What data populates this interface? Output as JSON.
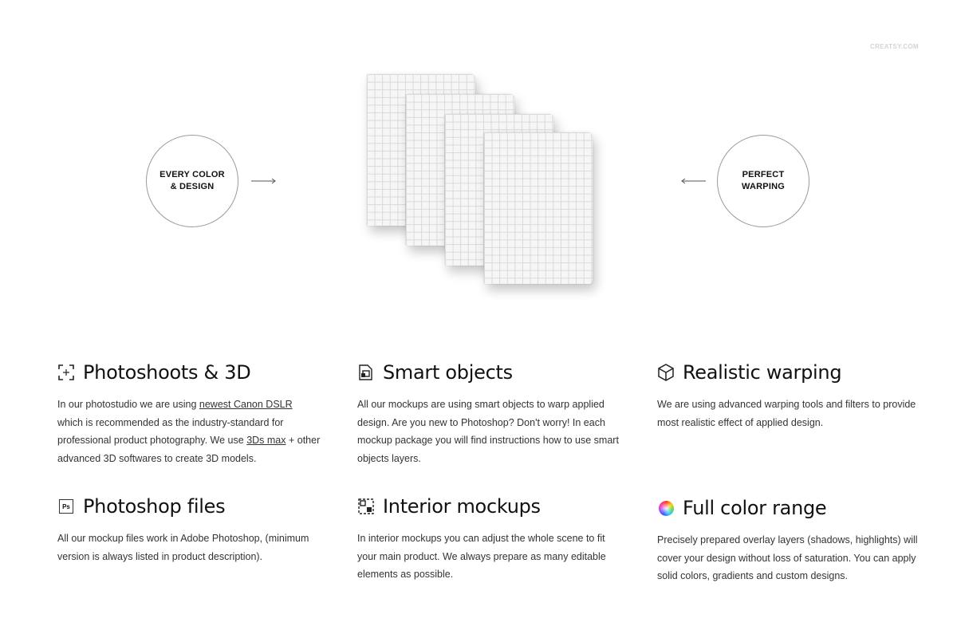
{
  "watermark": "CREATSY.COM",
  "left_circle": {
    "text": "EVERY COLOR\n& DESIGN"
  },
  "right_circle": {
    "text": "PERFECT\nWARPING"
  },
  "features": [
    {
      "icon": "photoshoot-frame-icon",
      "title": "Photoshoots & 3D",
      "text_parts": [
        "In our photostudio we are using ",
        "newest Canon DSLR",
        " which is recommended as the industry-standard for professional product photography.  We use ",
        "3Ds max",
        " + other advanced 3D softwares to create 3D models."
      ]
    },
    {
      "icon": "smart-object-icon",
      "title": "Smart objects",
      "text": "All our mockups are using smart objects to warp applied design. Are you new to Photoshop? Don't worry! In each mockup package you will find instructions how to use smart objects layers."
    },
    {
      "icon": "cube-icon",
      "title": "Realistic warping",
      "text": "We are using advanced warping tools and filters to provide most realistic effect of applied design."
    },
    {
      "icon": "photoshop-icon",
      "icon_text": "Ps",
      "title": "Photoshop files",
      "text": "All our mockup files work in Adobe Photoshop, (minimum version is always listed in product description)."
    },
    {
      "icon": "interior-layout-icon",
      "title": "Interior mockups",
      "text": "In interior mockups you can adjust the whole scene to fit your main product. We always prepare as many editable elements as possible."
    },
    {
      "icon": "color-wheel-icon",
      "title": "Full color range",
      "text": "Precisely prepared overlay layers (shadows, highlights) will cover your design without loss of saturation. You can apply solid colors, gradients and custom designs."
    }
  ]
}
